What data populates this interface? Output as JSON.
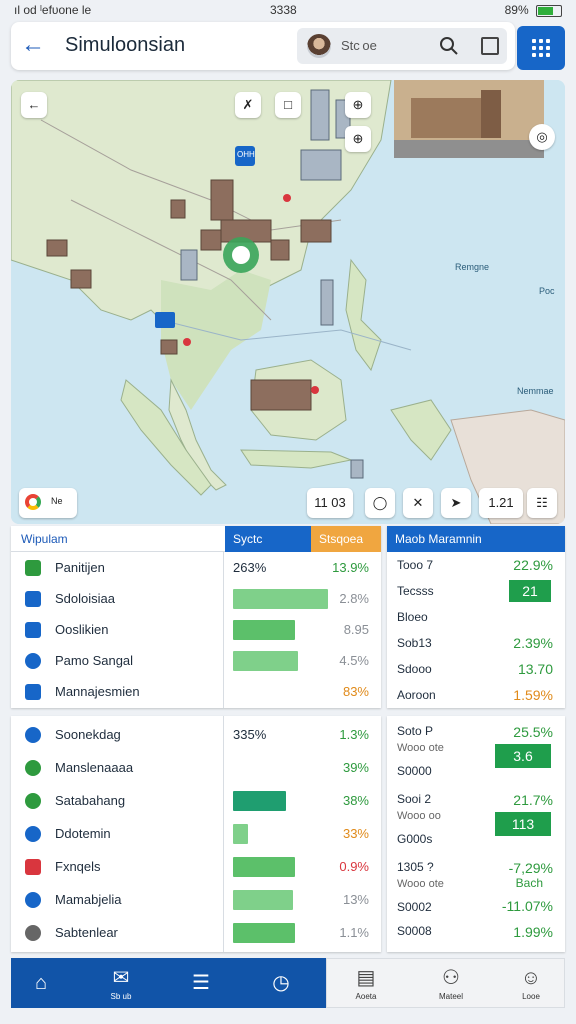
{
  "status_bar": {
    "left": "ıl ᴏd ˡefᴜᴏne l͏e",
    "time": "3338",
    "battery": "89%"
  },
  "header": {
    "title": "Simuloonsian",
    "search_label": "Stc oe"
  },
  "map": {
    "zoom_readout": "11 03",
    "scale_readout": "1.21",
    "labels": {
      "east_sea": "Remgne",
      "pacific": "Poc",
      "southeast": "Nemmae"
    },
    "poi_label": "OHH",
    "poi_label2": "Ne"
  },
  "table_left": {
    "header_name": "Wipulam",
    "header_mid": "Syctc",
    "header_right": "Stsqoea",
    "accent": "#1766c8",
    "orange": "#f0a640",
    "rows": [
      {
        "icon": "table-icon",
        "name": "Panitijen",
        "mid": "263%",
        "value": "13.9%",
        "bar": 0,
        "value_color": "green"
      },
      {
        "icon": "plus-icon",
        "name": "Sdoloisiaa",
        "mid": "",
        "value": "2.8%",
        "bar": 0.95,
        "value_color": "gray"
      },
      {
        "icon": "x-square-icon",
        "name": "Ooslikien",
        "mid": "",
        "value": "8.95",
        "bar": 0.62,
        "value_color": "gray"
      },
      {
        "icon": "edit-circle-icon",
        "name": "Pamo Sangal",
        "mid": "",
        "value": "4.5%",
        "bar": 0.65,
        "value_color": "gray"
      },
      {
        "icon": "list-icon",
        "name": "Mannajesmien",
        "mid": "",
        "value": "83%",
        "bar": 0,
        "value_color": "orange"
      }
    ]
  },
  "table_right": {
    "header": "Maob Maramnin",
    "rows": [
      {
        "label": "Tooo 7",
        "value": "22.9%",
        "sub": "",
        "badge": ""
      },
      {
        "label": "Tecsss",
        "value": "",
        "sub": "",
        "badge": "21"
      },
      {
        "label": "Bloeo",
        "value": "",
        "sub": "",
        "badge": ""
      },
      {
        "label": "Sob13",
        "value": "2.39%",
        "sub": "",
        "badge": ""
      },
      {
        "label": "Sdooo",
        "value": "13.70",
        "sub": "",
        "badge": ""
      },
      {
        "label": "Aoroon",
        "value": "1.59%",
        "sub": "",
        "badge": ""
      }
    ]
  },
  "table_left2": {
    "rows": [
      {
        "icon": "link-circle-icon",
        "name": "Soonekdag",
        "mid": "335%",
        "value": "1.3%",
        "bar": 0,
        "value_color": "green"
      },
      {
        "icon": "check-circle-icon",
        "name": "Manslenaaaa",
        "mid": "",
        "value": "39%",
        "bar": 0,
        "value_color": "green"
      },
      {
        "icon": "check-circle-icon",
        "name": "Satabahang",
        "mid": "",
        "value": "38%",
        "bar": 0.53,
        "value_color": "green"
      },
      {
        "icon": "target-icon",
        "name": "Ddotemin",
        "mid": "",
        "value": "33%",
        "bar": 0.15,
        "value_color": "orange"
      },
      {
        "icon": "chat-icon",
        "name": "Fxnqels",
        "mid": "",
        "value": "0.9%",
        "bar": 0.62,
        "value_color": "red"
      },
      {
        "icon": "circle-icon",
        "name": "Mamabjelia",
        "mid": "",
        "value": "13%",
        "bar": 0.6,
        "value_color": "gray"
      },
      {
        "icon": "gear-icon",
        "name": "Sabtenlear",
        "mid": "",
        "value": "1.1%",
        "bar": 0.62,
        "value_color": "gray"
      }
    ]
  },
  "table_right2": {
    "rows": [
      {
        "label": "Soto P",
        "sub": "Wooo ote",
        "value": "25.5%",
        "badge": "3.6",
        "foot": "S0000"
      },
      {
        "label": "Sooi 2",
        "sub": "Wooo oo",
        "value": "21.7%",
        "badge": "113",
        "foot": "G000s"
      },
      {
        "label": "1305 ?",
        "sub": "Wooo ote",
        "value": "-7,29%",
        "value2": "Bach",
        "badge": "",
        "foot": "S0002",
        "foot_value": "-11.07%"
      },
      {
        "label": "",
        "sub": "",
        "value": "",
        "badge": "",
        "foot": "S0008",
        "foot_value": "1.99%"
      }
    ]
  },
  "nav": {
    "items": [
      {
        "icon": "home-icon",
        "label": ""
      },
      {
        "icon": "mail-icon",
        "label": "Sb ub"
      },
      {
        "icon": "list-icon",
        "label": ""
      },
      {
        "icon": "clock-icon",
        "label": ""
      },
      {
        "icon": "building-icon",
        "label": "Aoeta"
      },
      {
        "icon": "user-icon",
        "label": "Mateel"
      },
      {
        "icon": "profile-icon",
        "label": "Looe"
      }
    ]
  }
}
